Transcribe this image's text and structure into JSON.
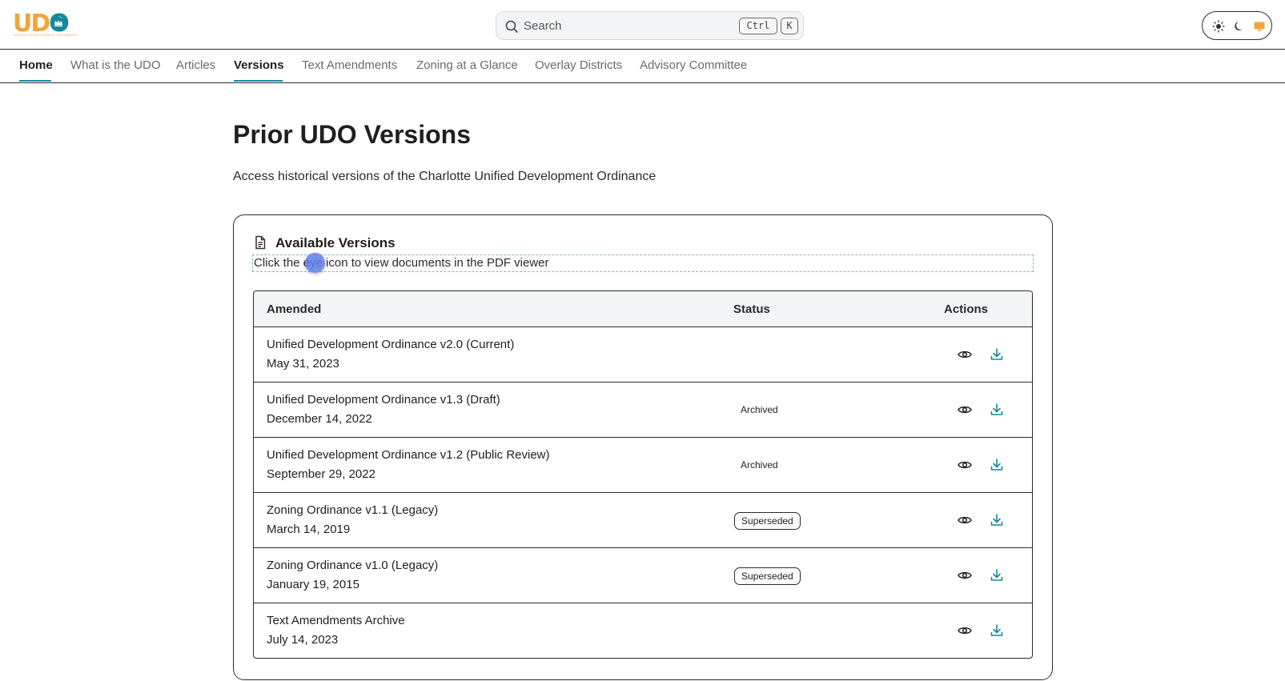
{
  "brand": {
    "logo_text": "UDO",
    "logo_subtitle": "UNIFIED DEVELOPMENT ORDINANCE",
    "colors": {
      "orange": "#f0a53b",
      "teal": "#138a9c"
    }
  },
  "search": {
    "placeholder": "Search",
    "shortcut_keys": [
      "Ctrl",
      "K"
    ]
  },
  "theme_toggle": {
    "options": [
      "light",
      "dark",
      "system"
    ],
    "selected": "system"
  },
  "nav": {
    "items": [
      {
        "label": "Home",
        "active": true
      },
      {
        "label": "What is the UDO",
        "active": false
      },
      {
        "label": "Articles",
        "active": false
      },
      {
        "label": "Versions",
        "active": true
      },
      {
        "label": "Text Amendments",
        "active": false
      },
      {
        "label": "Zoning at a Glance",
        "active": false
      },
      {
        "label": "Overlay Districts",
        "active": false
      },
      {
        "label": "Advisory Committee",
        "active": false
      }
    ]
  },
  "page": {
    "title": "Prior UDO Versions",
    "subtitle": "Access historical versions of the Charlotte Unified Development Ordinance"
  },
  "card": {
    "icon": "document-icon",
    "title": "Available Versions",
    "description": "Click the eye icon to view documents in the PDF viewer"
  },
  "table": {
    "headers": {
      "amended": "Amended",
      "status": "Status",
      "actions": "Actions"
    },
    "rows": [
      {
        "name": "Unified Development Ordinance v2.0 (Current)",
        "date": "May 31, 2023",
        "status": "",
        "status_style": "none"
      },
      {
        "name": "Unified Development Ordinance v1.3 (Draft)",
        "date": "December 14, 2022",
        "status": "Archived",
        "status_style": "plain"
      },
      {
        "name": "Unified Development Ordinance v1.2 (Public Review)",
        "date": "September 29, 2022",
        "status": "Archived",
        "status_style": "plain"
      },
      {
        "name": "Zoning Ordinance v1.1 (Legacy)",
        "date": "March 14, 2019",
        "status": "Superseded",
        "status_style": "outline"
      },
      {
        "name": "Zoning Ordinance v1.0 (Legacy)",
        "date": "January 19, 2015",
        "status": "Superseded",
        "status_style": "outline"
      },
      {
        "name": "Text Amendments Archive",
        "date": "July 14, 2023",
        "status": "",
        "status_style": "none"
      }
    ],
    "action_icons": [
      "eye-icon",
      "download-icon"
    ]
  }
}
